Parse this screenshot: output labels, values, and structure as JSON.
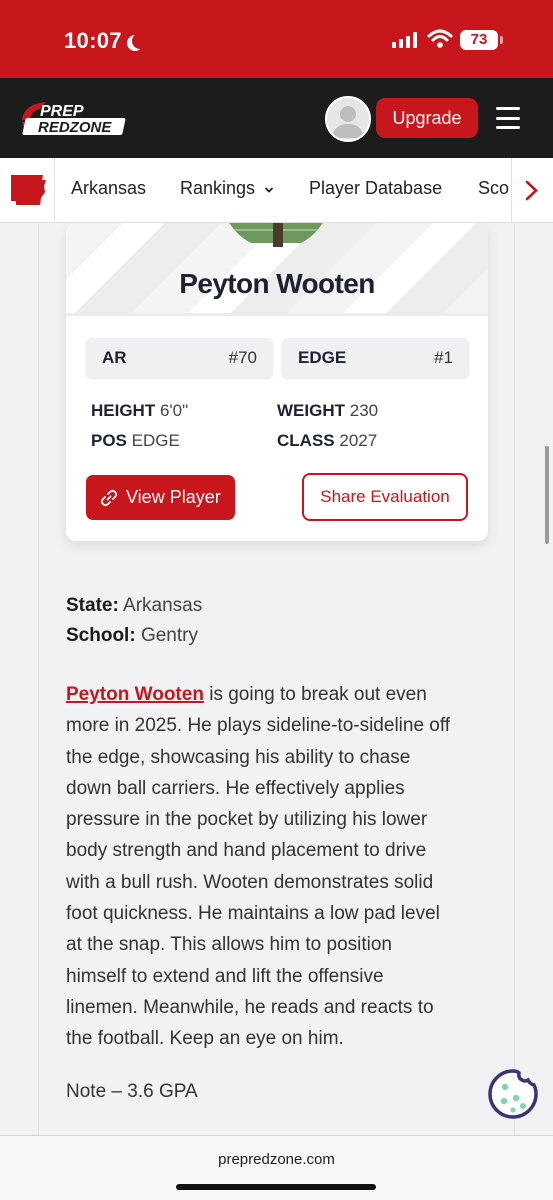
{
  "status_bar": {
    "time": "10:07",
    "battery": "73"
  },
  "header": {
    "logo_top": "PREP",
    "logo_bottom": "REDZONE",
    "upgrade_label": "Upgrade"
  },
  "nav": {
    "items": [
      "Arkansas",
      "Rankings",
      "Player Database",
      "Sco"
    ]
  },
  "player": {
    "name": "Peyton Wooten",
    "state_abbr": "AR",
    "state_rank": "#70",
    "position": "EDGE",
    "position_rank": "#1",
    "height_label": "HEIGHT",
    "height_value": "6'0\"",
    "weight_label": "WEIGHT",
    "weight_value": "230",
    "pos_label": "POS",
    "pos_value": "EDGE",
    "class_label": "CLASS",
    "class_value": "2027",
    "view_label": "View Player",
    "share_label": "Share Evaluation"
  },
  "info": {
    "state_label": "State:",
    "state_value": "Arkansas",
    "school_label": "School:",
    "school_value": "Gentry"
  },
  "article": {
    "lines": [
      "is going to break out even",
      "more in 2025. He plays sideline-to-sideline off",
      "the edge, showcasing his ability to chase",
      "down ball carriers. He effectively applies",
      "pressure in the pocket by utilizing his lower",
      "body strength and hand placement to drive",
      "with a bull rush. Wooten demonstrates solid",
      "foot quickness. He maintains a low pad level",
      "at the snap. This allows him to position",
      "himself to extend and lift the offensive",
      "linemen. Meanwhile, he reads and reacts to",
      "the football. Keep an eye on him."
    ],
    "note": "Note – 3.6 GPA"
  },
  "browser": {
    "url": "prepredzone.com"
  },
  "colors": {
    "brand_red": "#c8161d",
    "header_dark": "#1c1c1c",
    "cookie_purple": "#3a3578",
    "cookie_green": "#7fd6a8"
  }
}
